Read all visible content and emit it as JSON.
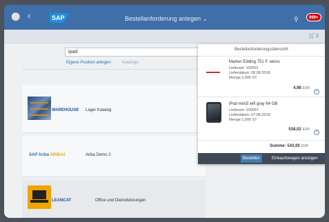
{
  "header": {
    "title": "Bestellanforderung anlegen",
    "logo_text": "SAP",
    "notification_count": "999+"
  },
  "subbar": {
    "cart_count": "2"
  },
  "search": {
    "value": "ipad"
  },
  "links": {
    "own_position": "Eigene Position anlegen",
    "catalogs": "Kataloge"
  },
  "catalogs": [
    {
      "brand": "WAREHOUSE",
      "label": "Lager Katalog"
    },
    {
      "brand_part1": "SAP Ariba",
      "brand_part2": "ARIBA2",
      "label": "Ariba Demo 2"
    },
    {
      "brand": "LEANCAT",
      "label": "Office und Dienstleistungen"
    }
  ],
  "cart_popover": {
    "title": "Bestellanforderungsübersicht",
    "items": [
      {
        "name": "Marker Edding 751 F. weiss",
        "supplier": "Lieferant:  100031",
        "delivery": "Lieferdatum: 08.08.2018",
        "quantity": "Menge:1,000 ST",
        "price": "4,98",
        "currency": "EUR"
      },
      {
        "name": "iPad mini3 wifi gray 64 GB",
        "supplier": "Lieferant:  100057",
        "delivery": "Lieferdatum: 07.08.2018",
        "quantity": "Menge:1,000 ST",
        "price": "538,02",
        "currency": "EUR"
      }
    ],
    "sum_label": "Summe:",
    "sum_value": "543,00",
    "sum_currency": "EUR",
    "order_button": "Bestellen",
    "show_cart_button": "Einkaufswagen anzeigen"
  },
  "colors": {
    "shell": "#3e6fa8",
    "accent": "#427cac",
    "badge": "#d30b0b"
  }
}
